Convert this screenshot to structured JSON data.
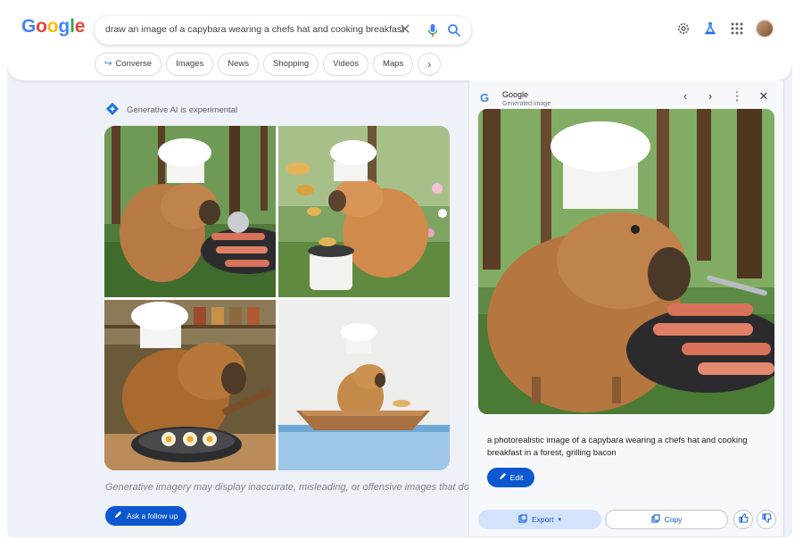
{
  "header": {
    "logo": [
      "G",
      "o",
      "o",
      "g",
      "l",
      "e"
    ],
    "search": {
      "query": "draw an image of a capybara wearing a chefs hat and cooking breakfast",
      "clear_icon": "close-icon",
      "mic_icon": "mic-icon",
      "lens_icon": "search-icon"
    },
    "icons": [
      "gear-icon",
      "labs-flask-icon",
      "apps-grid-icon",
      "avatar"
    ]
  },
  "chips": [
    {
      "label": "Converse",
      "icon": "return-arrow-icon"
    },
    {
      "label": "Images"
    },
    {
      "label": "News"
    },
    {
      "label": "Shopping"
    },
    {
      "label": "Videos"
    },
    {
      "label": "Maps"
    }
  ],
  "main": {
    "gen_label": "Generative AI is experimental",
    "images": [
      "capybara-bbq",
      "capybara-pot",
      "capybara-pan",
      "capybara-boat"
    ],
    "disclaimer": "Generative imagery may display inaccurate, misleading, or offensive images that do",
    "ask_followup": "Ask a follow up"
  },
  "panel": {
    "source_name": "Google",
    "source_sub": "Generated image",
    "caption": "a photorealistic image of a capybara wearing a chefs hat and cooking breakfast in a forest, grilling bacon",
    "edit_label": "Edit",
    "export_label": "Export",
    "copy_label": "Copy"
  },
  "colors": {
    "accent": "#0b57d0",
    "google_blue": "#4285f4",
    "google_red": "#ea4335",
    "google_yellow": "#fbbc05",
    "google_green": "#34a853"
  }
}
